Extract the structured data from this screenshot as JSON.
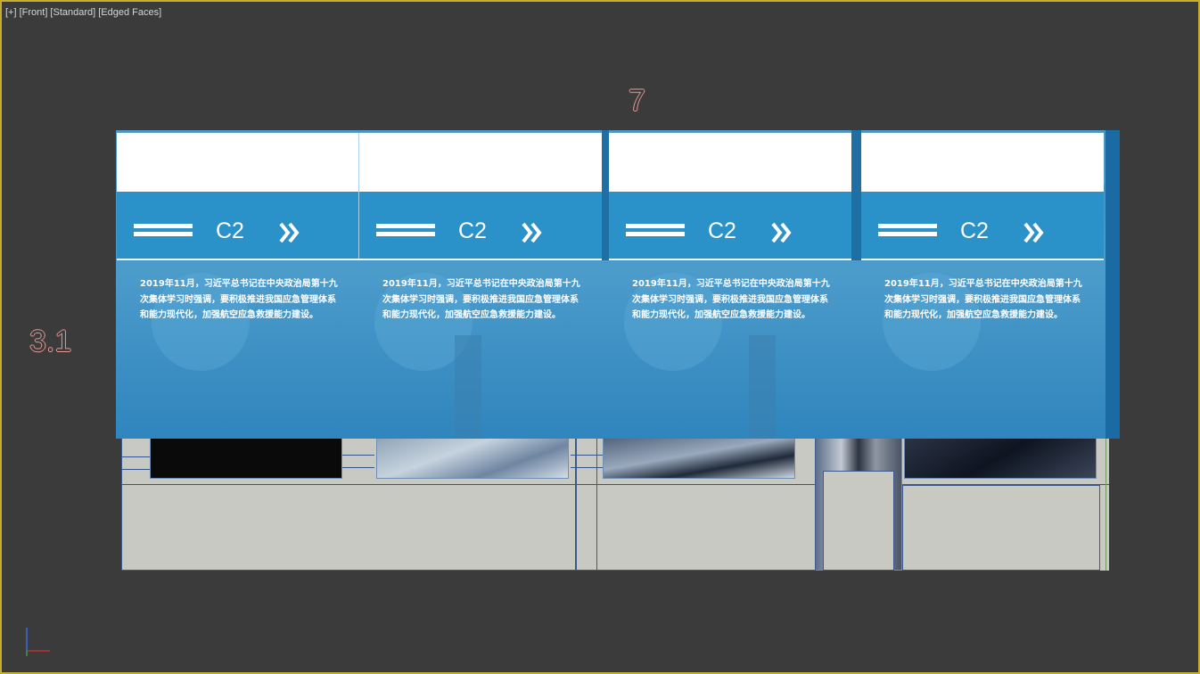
{
  "viewport": {
    "label": "[+] [Front] [Standard] [Edged Faces]",
    "border_color": "#c8ac2c",
    "background": "#3b3b3b"
  },
  "dimensions": {
    "top": "7",
    "left": "3.1"
  },
  "panels": [
    {
      "title": "C2",
      "text": "2019年11月，习近平总书记在中央政治局第十九次集体学习时强调，要积极推进我国应急管理体系和能力现代化，加强航空应急救援能力建设。"
    },
    {
      "title": "C2",
      "text": "2019年11月，习近平总书记在中央政治局第十九次集体学习时强调，要积极推进我国应急管理体系和能力现代化，加强航空应急救援能力建设。"
    },
    {
      "title": "C2",
      "text": "2019年11月，习近平总书记在中央政治局第十九次集体学习时强调，要积极推进我国应急管理体系和能力现代化，加强航空应急救援能力建设。"
    },
    {
      "title": "C2",
      "text": "2019年11月，习近平总书记在中央政治局第十九次集体学习时强调，要积极推进我国应急管理体系和能力现代化，加强航空应急救援能力建设。"
    }
  ],
  "icons": {
    "menu": "horizontal-lines-icon",
    "next": "double-chevron-right-icon",
    "axis": "axis-gizmo-icon"
  },
  "colors": {
    "banner_blue": "#2a92c9",
    "dimension_outline": "#e69a9a",
    "model_gray": "#c8c9c3"
  }
}
